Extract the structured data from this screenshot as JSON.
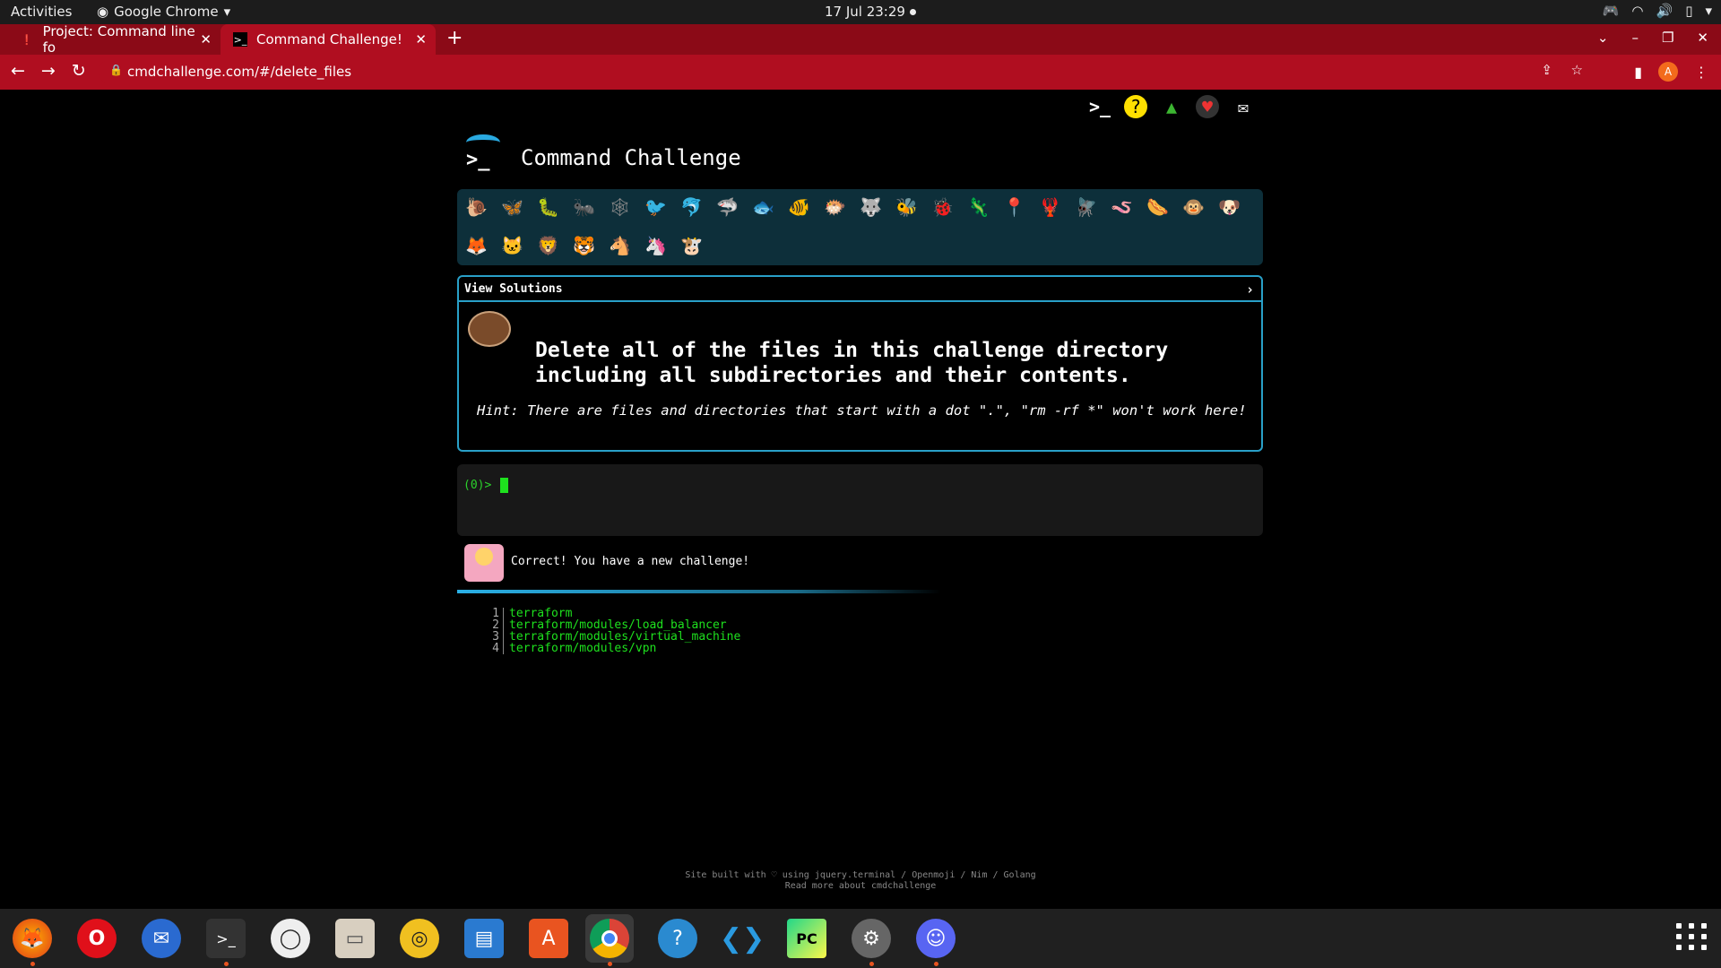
{
  "topbar": {
    "activities": "Activities",
    "app_name": "Google Chrome",
    "clock": "17 Jul  23:29"
  },
  "browser": {
    "tabs": [
      {
        "title": "Project: Command line fo"
      },
      {
        "title": "Command Challenge!"
      }
    ],
    "url": "cmdchallenge.com/#/delete_files",
    "profile_initial": "A"
  },
  "page": {
    "site_title": "Command Challenge",
    "view_solutions": "View Solutions",
    "challenge_description": "Delete all of the files in this challenge directory including all subdirectories and their contents.",
    "hint": "Hint: There are files and directories that start with a dot \".\", \"rm -rf *\" won't work here!",
    "prompt": "(0)> ",
    "result_message": "Correct! You have a new challenge!",
    "output_lines": [
      {
        "num": "1",
        "text": "terraform"
      },
      {
        "num": "2",
        "text": "terraform/modules/load_balancer"
      },
      {
        "num": "3",
        "text": "terraform/modules/virtual_machine"
      },
      {
        "num": "4",
        "text": "terraform/modules/vpn"
      }
    ],
    "footer_line1": "Site built with ♡ using jquery.terminal / Openmoji / Nim / Golang",
    "footer_line2": "Read more about cmdchallenge",
    "badges": [
      "snail",
      "butterfly",
      "caterpillar",
      "ant",
      "spider-web",
      "bird",
      "dolphin",
      "shark",
      "fish",
      "tropical-fish",
      "pufferfish",
      "wolf",
      "bee",
      "ladybug",
      "lizard",
      "pin",
      "lobster",
      "fly",
      "worm",
      "sausage",
      "monkey",
      "dog",
      "fox",
      "cat",
      "lion",
      "tiger",
      "horse",
      "unicorn",
      "ox"
    ]
  },
  "dock": {
    "apps": [
      "firefox",
      "opera",
      "thunderbird",
      "terminal",
      "obs",
      "files",
      "rhythmbox",
      "writer",
      "app-center",
      "chrome",
      "help",
      "vscode",
      "pycharm",
      "settings",
      "discord"
    ]
  }
}
